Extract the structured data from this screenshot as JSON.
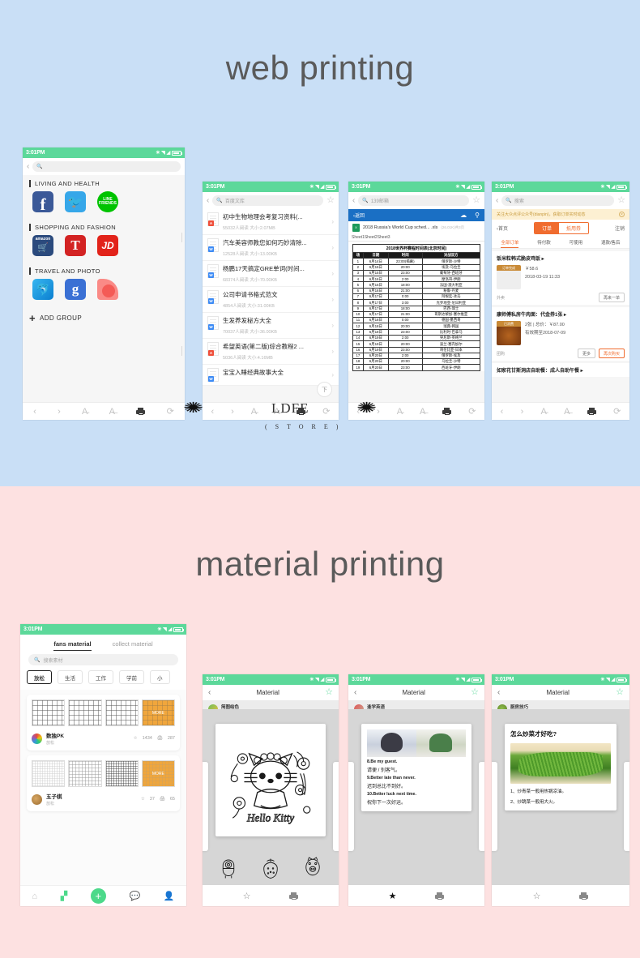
{
  "sections": [
    {
      "id": "web",
      "title": "web printing",
      "bg": "#c9dff6"
    },
    {
      "id": "material",
      "title": "material printing",
      "bg": "#fde1e1"
    }
  ],
  "status_bar": {
    "time": "3:01PM",
    "bluetooth": "bluetooth-icon",
    "wifi": "wifi-icon",
    "signal": "signal-icon",
    "battery": "battery-icon"
  },
  "watermark": {
    "brand": "LDFE",
    "sub": "( S T O R E )"
  },
  "phone1": {
    "search_placeholder": "",
    "groups": [
      {
        "title": "LIVING AND HEALTH",
        "apps": [
          {
            "name": "Facebook",
            "short": "f",
            "style": "ic-fb"
          },
          {
            "name": "Twitter",
            "short": "ᴠ",
            "style": "ic-tw"
          },
          {
            "name": "LINE FRIENDS",
            "short": "LINE",
            "sub": "FRIENDS",
            "style": "ic-line"
          }
        ]
      },
      {
        "title": "SHOPPING AND FASHION",
        "apps": [
          {
            "name": "amazon",
            "short": "amazon",
            "style": "ic-amazon"
          },
          {
            "name": "T",
            "short": "T",
            "style": "ic-t"
          },
          {
            "name": "JD",
            "short": "JD",
            "style": "ic-jd"
          }
        ]
      },
      {
        "title": "TRAVEL AND PHOTO",
        "apps": [
          {
            "name": "Dolphin",
            "short": "◕",
            "style": "ic-dolphin"
          },
          {
            "name": "Google",
            "short": "g",
            "style": "ic-google"
          },
          {
            "name": "Red",
            "short": "",
            "style": "ic-red"
          }
        ]
      }
    ],
    "add_group": "ADD GROUP",
    "toolbar": [
      "back",
      "forward",
      "font-larger",
      "font-smaller",
      "print",
      "refresh"
    ]
  },
  "phone2": {
    "search_value": "百度文库",
    "docs": [
      {
        "title": "初中生物地理会考复习资料(...",
        "meta": "55032人阅读  大小:2.07MB",
        "type": "PDF"
      },
      {
        "title": "汽车美容师教您如何巧妙清除...",
        "meta": "12528人阅读  大小:13.00KB",
        "type": "DOC"
      },
      {
        "title": "杨鹏17天搞定GRE单词(时间...",
        "meta": "68374人阅读  大小:70.00KB",
        "type": "DOC"
      },
      {
        "title": "公司申请书格式范文",
        "meta": "4854人阅读  大小:31.00KB",
        "type": "DOC"
      },
      {
        "title": "生发养发秘方大全",
        "meta": "70037人阅读  大小:36.00KB",
        "type": "DOC"
      },
      {
        "title": "希望英语(第二版)综合教程2 ...",
        "meta": "5036人阅读  大小:4.16MB",
        "type": "PDF"
      },
      {
        "title": "宝宝入睡经典故事大全",
        "meta": "",
        "type": "DOC"
      }
    ],
    "fab_label": "下"
  },
  "phone3": {
    "search_value": "139邮箱",
    "blue_bar": {
      "back": "返回",
      "download": "download-icon",
      "more": "more-icon"
    },
    "file_name": "2018 Russia's World Cup sched... .xls",
    "file_size": "(26.01K)共3页",
    "sheet_tabs": "Sheet1Sheet2Sheet3",
    "table_caption": "2018世界杯赛程时间表(北京时间)",
    "table_headers": [
      "场",
      "日期",
      "时间",
      "对战双方"
    ],
    "table_rows": [
      [
        "1",
        "6月14日",
        "23:00(揭幕)",
        "俄罗斯-沙特"
      ],
      [
        "2",
        "6月15日",
        "20:00",
        "埃及-乌拉圭"
      ],
      [
        "3",
        "6月15日",
        "23:00",
        "葡萄牙-西班牙"
      ],
      [
        "4",
        "6月16日",
        "2:00",
        "摩洛哥-伊朗"
      ],
      [
        "5",
        "6月16日",
        "18:00",
        "法国-澳大利亚"
      ],
      [
        "6",
        "6月16日",
        "21:00",
        "秘鲁-丹麦"
      ],
      [
        "7",
        "6月17日",
        "0:00",
        "阿根廷-冰岛"
      ],
      [
        "8",
        "6月17日",
        "3:00",
        "克罗地亚-尼日利亚"
      ],
      [
        "9",
        "6月17日",
        "18:00",
        "巴西-瑞士"
      ],
      [
        "10",
        "6月17日",
        "21:00",
        "哥斯达黎加-塞尔维亚"
      ],
      [
        "11",
        "6月18日",
        "0:00",
        "德国-墨西哥"
      ],
      [
        "12",
        "6月18日",
        "20:00",
        "瑞典-韩国"
      ],
      [
        "13",
        "6月18日",
        "23:00",
        "比利时-巴拿马"
      ],
      [
        "14",
        "6月19日",
        "2:00",
        "突尼斯-英格兰"
      ],
      [
        "15",
        "6月19日",
        "20:00",
        "波兰-塞内加尔"
      ],
      [
        "16",
        "6月19日",
        "23:00",
        "哥伦比亚-日本"
      ],
      [
        "17",
        "6月20日",
        "2:00",
        "俄罗斯-埃及"
      ],
      [
        "18",
        "6月20日",
        "20:00",
        "乌拉圭-沙特"
      ],
      [
        "19",
        "6月20日",
        "23:00",
        "西班牙-伊朗"
      ]
    ]
  },
  "phone4": {
    "search_placeholder": "搜索",
    "promo": "关注大众点评公众号(dianpin)，获取订单实时动态",
    "home_label": "首页",
    "segments": [
      {
        "label": "订单",
        "active": true
      },
      {
        "label": "抵用券",
        "active": false
      }
    ],
    "note_label": "注销",
    "subtabs": [
      {
        "label": "全部订单",
        "active": true
      },
      {
        "label": "待付款",
        "active": false
      },
      {
        "label": "可使用",
        "active": false
      },
      {
        "label": "退款/售后",
        "active": false
      }
    ],
    "orders": [
      {
        "title": "饭米粒韩式脆皮鸡饭 ▸",
        "tag": "订单完成",
        "price": "￥58.6",
        "date": "2018-03-19 11:33",
        "foot_left": "外卖",
        "buttons": [
          {
            "label": "再来一单",
            "style": "out"
          }
        ]
      },
      {
        "title": "康师傅私房牛肉面：代金券1张 ▸",
        "tag": "已消费",
        "price": "2张 | 总价：￥87.00",
        "date": "有效期至2018-07-09",
        "foot_left": "团购",
        "buttons": [
          {
            "label": "更多",
            "style": "out"
          },
          {
            "label": "再次购买",
            "style": "orange"
          }
        ]
      }
    ],
    "partial_row": "如家花甘斯洞店自助餐：成人自助午餐 ▸"
  },
  "phone5": {
    "tabs": [
      {
        "label": "fans material",
        "active": true
      },
      {
        "label": "collect material",
        "active": false
      }
    ],
    "search_placeholder": "搜索素材",
    "chips": [
      {
        "label": "放松",
        "selected": true
      },
      {
        "label": "生活",
        "selected": false
      },
      {
        "label": "工作",
        "selected": false
      },
      {
        "label": "学前",
        "selected": false
      },
      {
        "label": "小",
        "selected": false
      }
    ],
    "cards": [
      {
        "name": "数独PK",
        "sub": "放松",
        "stars": "1434",
        "prints": "287",
        "thumb_style": "sudoku",
        "more_label": "MORE"
      },
      {
        "name": "五子棋",
        "sub": "放松",
        "stars": "37",
        "prints": "65",
        "thumb_style": "go",
        "more_label": "MORE"
      }
    ],
    "navbar": [
      "home-icon",
      "grid-icon",
      "add-icon",
      "chat-icon",
      "profile-icon"
    ]
  },
  "phone6": {
    "title": "Material",
    "author": "简图绘色",
    "author_sub": "绘画",
    "artwork": "Hello Kitty",
    "bottom": [
      "star-icon",
      "print-icon"
    ]
  },
  "phone7": {
    "title": "Material",
    "author": "逢学英语",
    "author_sub": "英语",
    "lines": [
      "8.Be my guest.",
      "请便 / 别客气。",
      "9.Better late than never.",
      "迟到总比不到好。",
      "10.Better luck next time.",
      "祝你下一次好运。"
    ],
    "bottom": [
      "star-icon",
      "print-icon"
    ]
  },
  "phone8": {
    "title": "Material",
    "author": "厨房技巧",
    "author_sub": "生活",
    "heading": "怎么炒菜才好吃?",
    "steps": [
      "1、炒青菜一般用热锅凉油。",
      "2、炒跳菜一般用大火。"
    ],
    "bottom": [
      "star-icon",
      "print-icon"
    ]
  },
  "colors": {
    "status_green": "#5cd89a",
    "accent_orange": "#f06c2f",
    "blue_bg": "#c9dff6",
    "pink_bg": "#fde1e1",
    "doc_blue": "#1a6fc4"
  }
}
